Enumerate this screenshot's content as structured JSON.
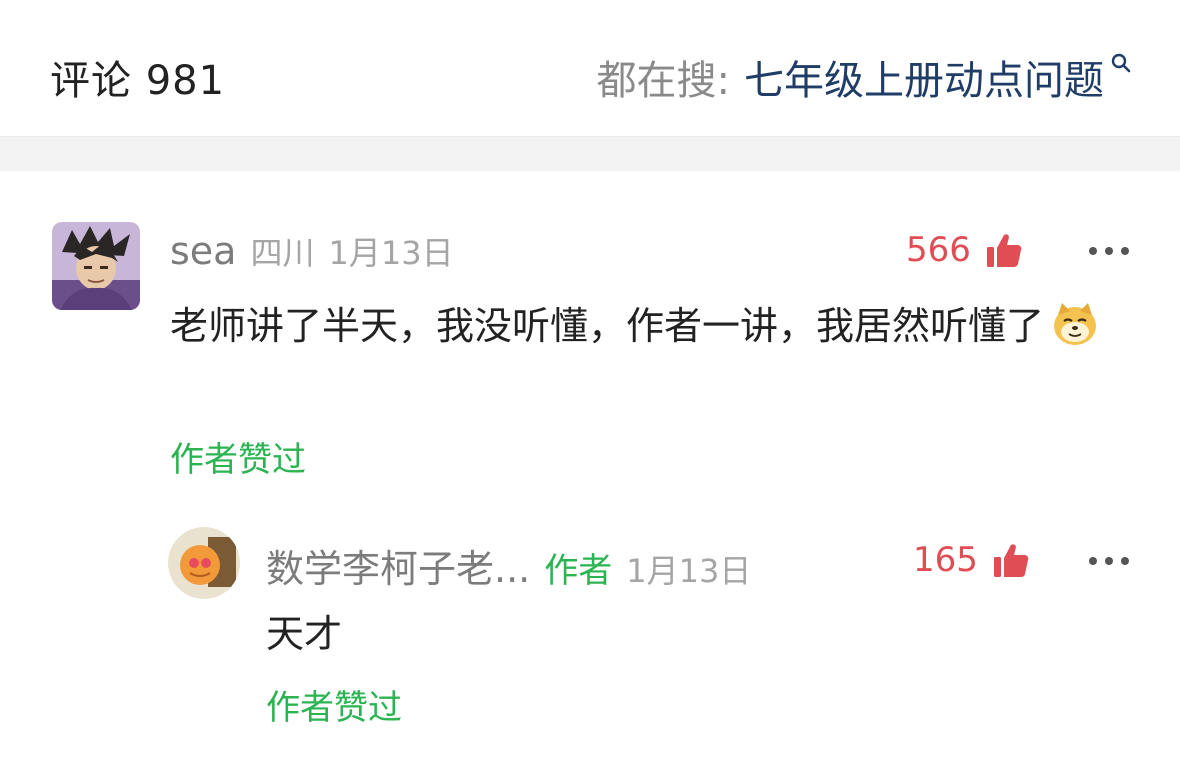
{
  "header": {
    "title": "评论 981",
    "search_prefix": "都在搜:",
    "search_keyword": "七年级上册动点问题",
    "search_icon": "search-icon"
  },
  "comments": [
    {
      "user": "sea",
      "location": "四川",
      "date": "1月13日",
      "likes": "566",
      "text": "老师讲了半天，我没听懂，作者一讲，我居然听懂了",
      "emoji": "doge-emoji",
      "author_liked": "作者赞过"
    }
  ],
  "reply": {
    "user": "数学李柯子老...",
    "tag": "作者",
    "date": "1月13日",
    "likes": "165",
    "text": "天才",
    "author_liked": "作者赞过"
  },
  "colors": {
    "like_red": "#e04d55",
    "author_green": "#2bb451",
    "keyword_blue": "#1f3d66"
  }
}
